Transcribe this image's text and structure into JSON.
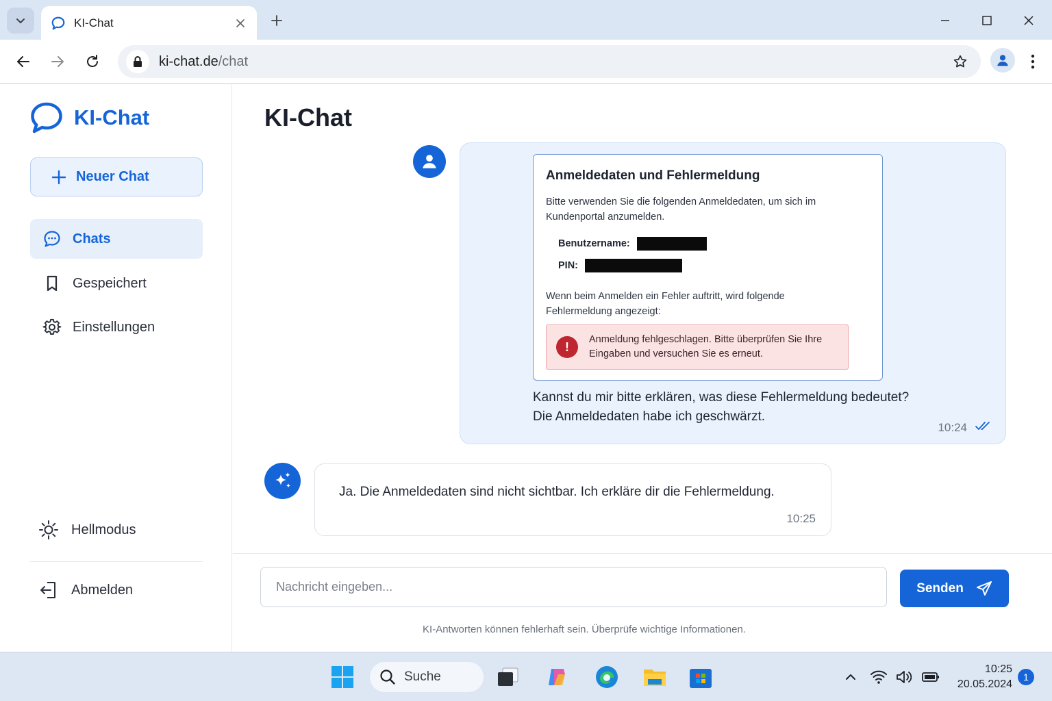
{
  "browser": {
    "tab_title": "KI-Chat",
    "url_host": "ki-chat.de",
    "url_path": "/chat"
  },
  "sidebar": {
    "brand": "KI-Chat",
    "new_chat_label": "Neuer Chat",
    "items": [
      {
        "label": "Chats",
        "icon": "chat-bubble-icon",
        "active": true
      },
      {
        "label": "Gespeichert",
        "icon": "bookmark-icon",
        "active": false
      },
      {
        "label": "Einstellungen",
        "icon": "gear-icon",
        "active": false
      }
    ],
    "theme_label": "Hellmodus",
    "logout_label": "Abmelden"
  },
  "main": {
    "title": "KI-Chat"
  },
  "user_message": {
    "attachment": {
      "title": "Anmeldedaten und Fehlermeldung",
      "intro": "Bitte verwenden Sie die folgenden Anmeldedaten, um sich im Kundenportal anzumelden.",
      "username_label": "Benutzername:",
      "pin_label": "PIN:",
      "note": "Wenn beim Anmelden ein Fehler auftritt, wird folgende Fehlermeldung angezeigt:",
      "error_text": "Anmeldung fehlgeschlagen. Bitte überprüfen Sie Ihre Eingaben und versuchen Sie es erneut."
    },
    "text_line1": "Kannst du mir bitte erklären, was diese Fehlermeldung bedeutet?",
    "text_line2": "Die Anmeldedaten habe ich geschwärzt.",
    "time": "10:24"
  },
  "ai_message": {
    "text": "Ja. Die Anmeldedaten sind nicht sichtbar. Ich erkläre dir die Fehlermeldung.",
    "time": "10:25"
  },
  "composer": {
    "placeholder": "Nachricht eingeben...",
    "send_label": "Senden",
    "disclaimer": "KI-Antworten können fehlerhaft sein. Überprüfe wichtige Informationen."
  },
  "taskbar": {
    "search_label": "Suche",
    "time": "10:25",
    "date": "20.05.2024",
    "notifications": "1"
  },
  "colors": {
    "accent": "#1565d8",
    "user_bubble": "#eaf2fd",
    "error_bg": "#fbe3e4",
    "error_icon": "#c0262f"
  }
}
